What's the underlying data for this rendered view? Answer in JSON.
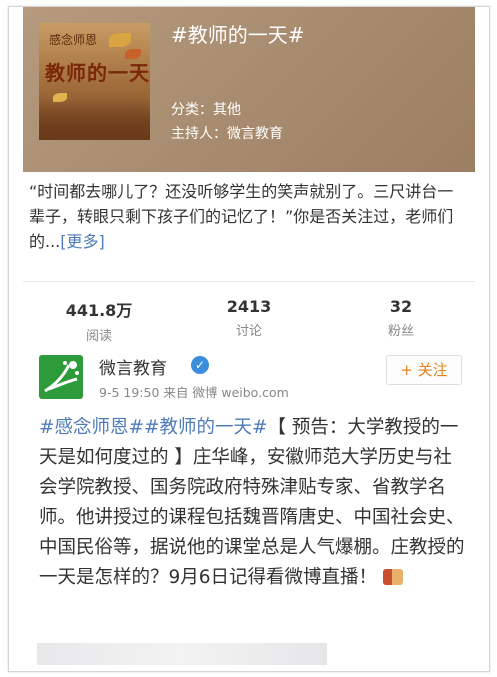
{
  "topic": {
    "title": "#教师的一天#",
    "cover": {
      "small_text": "感念师恩",
      "big_text": "教师的一天"
    },
    "category": "分类：其他",
    "host": "主持人：微言教育",
    "description": "“时间都去哪儿了？还没听够学生的笑声就别了。三尺讲台一辈子，转眼只剩下孩子们的记忆了！”你是否关注过，老师们的...",
    "more_link": "[更多]"
  },
  "stats": [
    {
      "value": "441.8万",
      "label": "阅读"
    },
    {
      "value": "2413",
      "label": "讨论"
    },
    {
      "value": "32",
      "label": "粉丝"
    }
  ],
  "post": {
    "username": "微言教育",
    "verified_badge": "✓",
    "time": "9-5 19:50",
    "source": "来自 微博 weibo.com",
    "follow_label": "+ 关注",
    "topics": "#感念师恩##教师的一天#",
    "text": "【 预告：大学教授的一天是如何度过的 】庄华峰，安徽师范大学历史与社会学院教授、国务院政府特殊津贴专家、省教学名师。他讲授过的课程包括魏晋隋唐史、中国社会史、中国民俗等，据说他的课堂总是人气爆棚。庄教授的一天是怎样的？9月6日记得看微博直播！"
  },
  "colors": {
    "header_bg": "#a88c70",
    "link": "#4f7bb8",
    "follow": "#e0821e",
    "avatar": "#2e9b3a"
  }
}
